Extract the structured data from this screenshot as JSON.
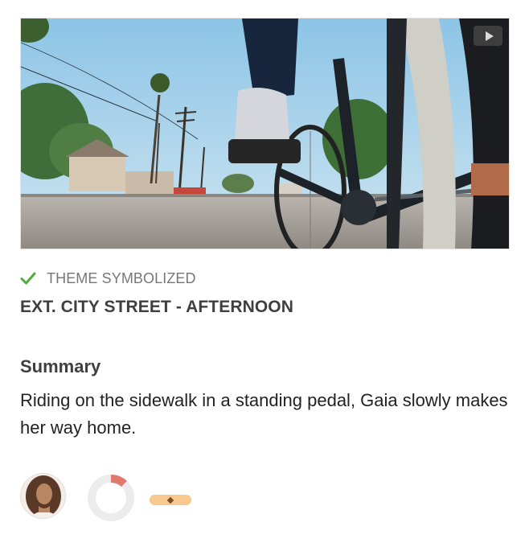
{
  "card": {
    "thumbnail": {
      "icon": "play-icon"
    },
    "status": {
      "icon": "checkmark-icon",
      "label": "THEME SYMBOLIZED",
      "color": "#4caf3a"
    },
    "scene_heading": "EXT. CITY STREET - AFTERNOON",
    "summary": {
      "title": "Summary",
      "text": "Riding on the sidewalk in a standing pedal, Gaia slowly makes her way home."
    },
    "footer": {
      "avatar_icon": "user-avatar",
      "progress": {
        "value": 0.12,
        "color": "#e07a6e",
        "track_color": "#ececec"
      },
      "tag": {
        "icon": "diamond-icon",
        "color": "#f7c98f"
      }
    }
  }
}
